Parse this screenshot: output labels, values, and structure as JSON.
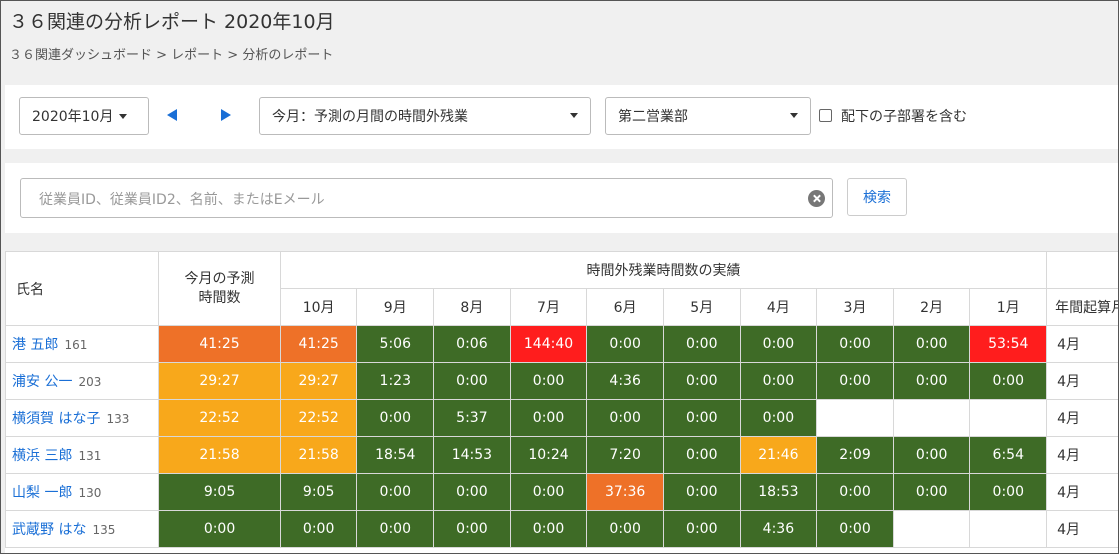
{
  "header": {
    "title": "３６関連の分析レポート 2020年10月",
    "breadcrumb": "３６関連ダッシュボード > レポート > 分析のレポート"
  },
  "filters": {
    "month_select": "2020年10月",
    "report_select": "今月：予測の月間の時間外残業",
    "department_select": "第二営業部",
    "include_sub_label": "配下の子部署を含む",
    "include_sub_checked": false
  },
  "search": {
    "placeholder": "従業員ID、従業員ID2、名前、またはEメール",
    "button_label": "検索"
  },
  "table": {
    "col_name": "氏名",
    "col_forecast": "今月の予測\n時間数",
    "col_actual_group": "時間外残業時間数の実績",
    "col_fiscal": "年間起算月",
    "months": [
      "10月",
      "9月",
      "8月",
      "7月",
      "6月",
      "5月",
      "4月",
      "3月",
      "2月",
      "1月"
    ],
    "colors": {
      "green": "#3e6b26",
      "orange": "#ee7128",
      "amber": "#f8a81b",
      "red": "#ff1d1d"
    },
    "rows": [
      {
        "name": "港 五郎",
        "id": "161",
        "forecast": "41:25",
        "forecast_color": "orange",
        "values": [
          "41:25",
          "5:06",
          "0:06",
          "144:40",
          "0:00",
          "0:00",
          "0:00",
          "0:00",
          "0:00",
          "53:54"
        ],
        "value_colors": [
          "orange",
          "green",
          "green",
          "red",
          "green",
          "green",
          "green",
          "green",
          "green",
          "red"
        ],
        "fiscal": "4月"
      },
      {
        "name": "浦安 公一",
        "id": "203",
        "forecast": "29:27",
        "forecast_color": "amber",
        "values": [
          "29:27",
          "1:23",
          "0:00",
          "0:00",
          "4:36",
          "0:00",
          "0:00",
          "0:00",
          "0:00",
          "0:00"
        ],
        "value_colors": [
          "amber",
          "green",
          "green",
          "green",
          "green",
          "green",
          "green",
          "green",
          "green",
          "green"
        ],
        "fiscal": "4月"
      },
      {
        "name": "横須賀 はな子",
        "id": "133",
        "forecast": "22:52",
        "forecast_color": "amber",
        "values": [
          "22:52",
          "0:00",
          "5:37",
          "0:00",
          "0:00",
          "0:00",
          "0:00",
          "",
          "",
          ""
        ],
        "value_colors": [
          "amber",
          "green",
          "green",
          "green",
          "green",
          "green",
          "green",
          "",
          "",
          ""
        ],
        "fiscal": "4月"
      },
      {
        "name": "横浜 三郎",
        "id": "131",
        "forecast": "21:58",
        "forecast_color": "amber",
        "values": [
          "21:58",
          "18:54",
          "14:53",
          "10:24",
          "7:20",
          "0:00",
          "21:46",
          "2:09",
          "0:00",
          "6:54"
        ],
        "value_colors": [
          "amber",
          "green",
          "green",
          "green",
          "green",
          "green",
          "amber",
          "green",
          "green",
          "green"
        ],
        "fiscal": "4月"
      },
      {
        "name": "山梨 一郎",
        "id": "130",
        "forecast": "9:05",
        "forecast_color": "green",
        "values": [
          "9:05",
          "0:00",
          "0:00",
          "0:00",
          "37:36",
          "0:00",
          "18:53",
          "0:00",
          "0:00",
          "0:00"
        ],
        "value_colors": [
          "green",
          "green",
          "green",
          "green",
          "orange",
          "green",
          "green",
          "green",
          "green",
          "green"
        ],
        "fiscal": "4月"
      },
      {
        "name": "武蔵野 はな",
        "id": "135",
        "forecast": "0:00",
        "forecast_color": "green",
        "values": [
          "0:00",
          "0:00",
          "0:00",
          "0:00",
          "0:00",
          "0:00",
          "4:36",
          "0:00",
          "",
          ""
        ],
        "value_colors": [
          "green",
          "green",
          "green",
          "green",
          "green",
          "green",
          "green",
          "green",
          "",
          ""
        ],
        "fiscal": "4月"
      }
    ]
  }
}
